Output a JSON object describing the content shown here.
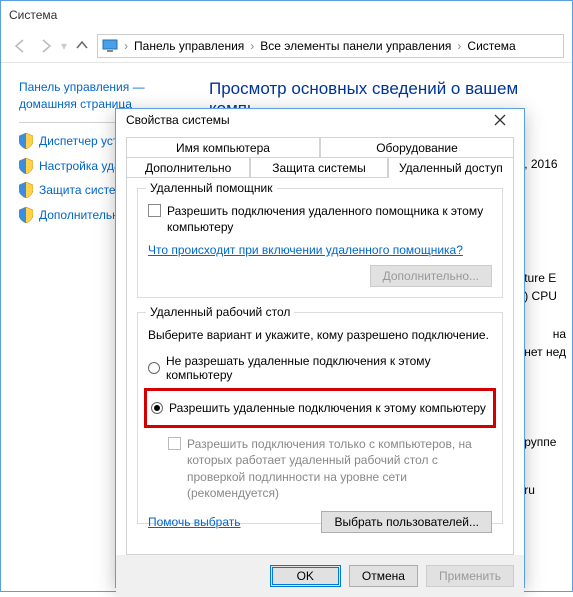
{
  "cp": {
    "title": "Система",
    "breadcrumb": [
      "Панель управления",
      "Все элементы панели управления",
      "Система"
    ],
    "home": "Панель управления — домашняя страница",
    "side_items": [
      "Диспетчер устр",
      "Настройка удал доступа",
      "Защита систем",
      "Дополнительны системы"
    ],
    "main_heading": "Просмотр основных сведений о вашем компь",
    "partial_right": [
      ", 2016",
      "ture E",
      ") CPU",
      "на",
      "нет нед",
      "руппе",
      "ru"
    ]
  },
  "dlg": {
    "title": "Свойства системы",
    "tabs": {
      "name": "Имя компьютера",
      "hardware": "Оборудование",
      "extra": "Дополнительно",
      "security": "Защита системы",
      "remote": "Удаленный доступ"
    },
    "group1": {
      "title": "Удаленный помощник",
      "chk": "Разрешить подключения удаленного помощника к этому компьютеру",
      "link": "Что происходит при включении удаленного помощника?",
      "extra_btn": "Дополнительно..."
    },
    "group2": {
      "title": "Удаленный рабочий стол",
      "desc": "Выберите вариант и укажите, кому разрешено подключение.",
      "radio_deny": "Не разрешать удаленные подключения к этому компьютеру",
      "radio_allow": "Разрешить удаленные подключения к этому компьютеру",
      "chk_nla": "Разрешить подключения только с компьютеров, на которых работает удаленный рабочий стол с проверкой подлинности на уровне сети (рекомендуется)",
      "help": "Помочь выбрать",
      "select_users": "Выбрать пользователей..."
    },
    "buttons": {
      "ok": "OK",
      "cancel": "Отмена",
      "apply": "Применить"
    }
  }
}
